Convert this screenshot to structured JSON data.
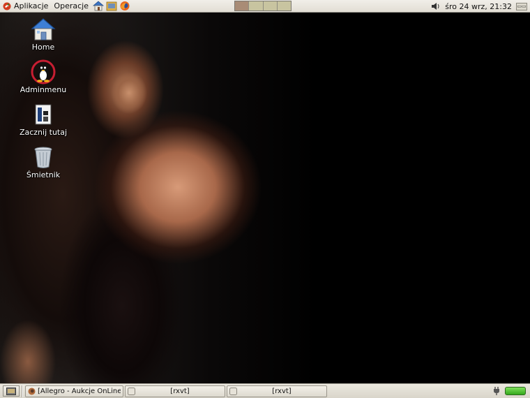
{
  "top_panel": {
    "menus": [
      {
        "label": "Aplikacje",
        "icon": "distro-logo-icon"
      },
      {
        "label": "Operacje"
      }
    ],
    "launchers": [
      "home-folder-icon",
      "file-manager-icon",
      "firefox-icon"
    ],
    "workspaces": {
      "count": 4,
      "active": 1
    },
    "clock": "śro 24 wrz, 21:32",
    "volume_icon": "speaker-icon",
    "keyboard_icon": "keyboard-layout-icon"
  },
  "desktop": {
    "icons": [
      {
        "label": "Home",
        "icon": "home-folder-icon"
      },
      {
        "label": "Adminmenu",
        "icon": "tux-penguin-icon"
      },
      {
        "label": "Zacznij tutaj",
        "icon": "start-here-icon"
      },
      {
        "label": "Śmietnik",
        "icon": "trash-icon"
      }
    ]
  },
  "bottom_panel": {
    "show_desktop_icon": "show-desktop-icon",
    "tasks": [
      {
        "label": "[Allegro - Aukcje OnLine - Mo",
        "icon": "firefox-icon"
      },
      {
        "label": "[rxvt]",
        "icon": "terminal-icon"
      },
      {
        "label": "[rxvt]",
        "icon": "terminal-icon"
      }
    ],
    "tray": [
      "power-plug-icon",
      "battery-icon"
    ],
    "battery_level": 1.0
  },
  "colors": {
    "panel_bg": "#e7e4db",
    "workspace_active": "#a98c76",
    "workspace_inactive": "#c8c4a0",
    "battery": "#48bf2a"
  }
}
